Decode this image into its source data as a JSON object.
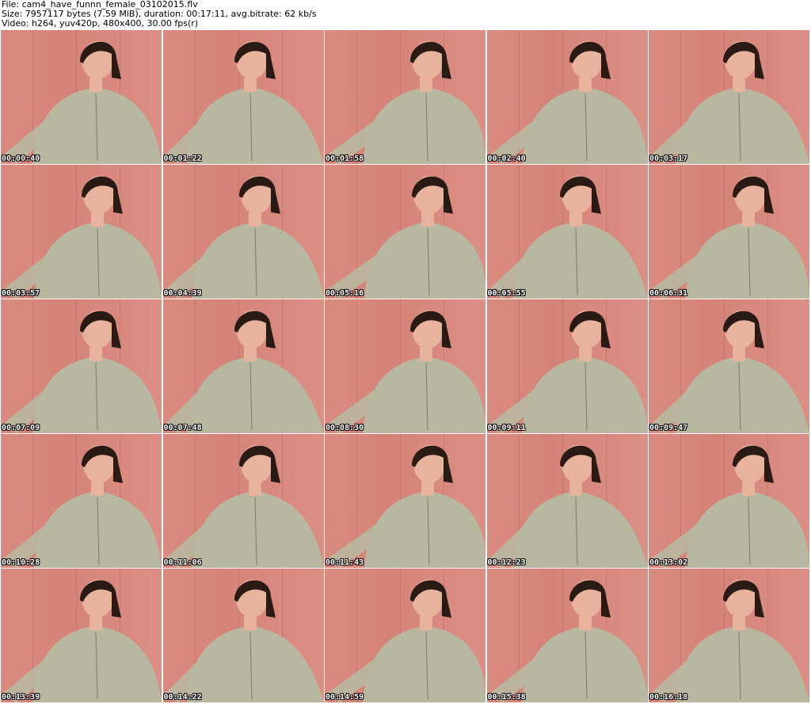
{
  "header": {
    "file_line": "File: cam4_have_funnn_female_03102015.flv",
    "size_line": "Size: 7957117 bytes (7.59 MiB), duration: 00:17:11, avg.bitrate: 62 kb/s",
    "video_line": "Video: h264, yuv420p, 480x400, 30.00 fps(r)"
  },
  "thumbnails": [
    "00:00:40",
    "00:01:22",
    "00:01:58",
    "00:02:40",
    "00:03:17",
    "00:03:57",
    "00:04:39",
    "00:05:16",
    "00:05:55",
    "00:06:31",
    "00:07:09",
    "00:07:48",
    "00:08:30",
    "00:09:11",
    "00:09:47",
    "00:10:28",
    "00:11:06",
    "00:11:43",
    "00:12:23",
    "00:13:02",
    "00:13:39",
    "00:14:22",
    "00:14:59",
    "00:15:38",
    "00:16:18"
  ],
  "colors": {
    "wall": "#d98b80",
    "sweater": "#b8b8a0",
    "hair": "#2a1a14",
    "skin": "#e7b39c"
  }
}
